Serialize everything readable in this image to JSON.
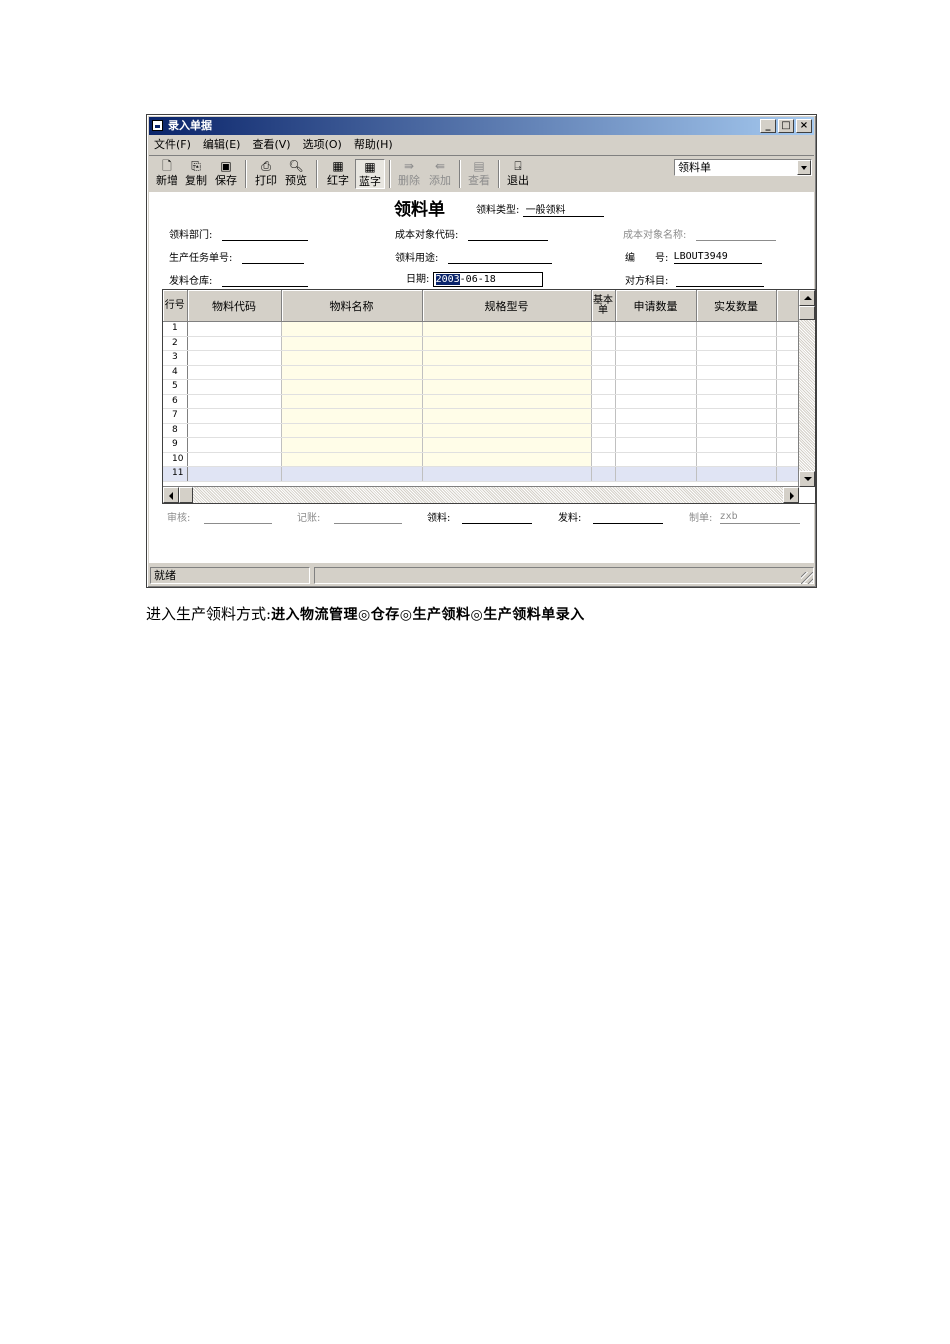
{
  "window": {
    "title": "录入单据",
    "controls": [
      "_",
      "□",
      "×"
    ]
  },
  "menu": [
    "文件(F)",
    "编辑(E)",
    "查看(V)",
    "选项(O)",
    "帮助(H)"
  ],
  "toolbar": {
    "new": "新增",
    "copy": "复制",
    "save": "保存",
    "print": "打印",
    "preview": "预览",
    "red": "红字",
    "blue": "蓝字",
    "delete": "删除",
    "add": "添加",
    "view": "查看",
    "exit": "退出",
    "doc_select": "领料单"
  },
  "form": {
    "title": "领料单",
    "pick_type_label": "领料类型:",
    "pick_type_value": "一般领料",
    "dept_label": "领料部门:",
    "task_label": "生产任务单号:",
    "warehouse_label": "发料仓库:",
    "cost_code_label": "成本对象代码:",
    "use_label": "领料用途:",
    "date_label": "日期:",
    "date_sel": "2003",
    "date_rest": "-06-18",
    "cost_name_label": "成本对象名称:",
    "number_label": "编　　号:",
    "number_value": "LBOUT3949",
    "contra_label": "对方科目:"
  },
  "grid": {
    "headers": [
      "行号",
      "物料代码",
      "物料名称",
      "规格型号",
      "基本单",
      "申请数量",
      "实发数量"
    ],
    "rows": [
      "1",
      "2",
      "3",
      "4",
      "5",
      "6",
      "7",
      "8",
      "9",
      "10",
      "11"
    ]
  },
  "footer": {
    "audit_label": "审核:",
    "post_label": "记账:",
    "picker_label": "领料:",
    "issuer_label": "发料:",
    "maker_label": "制单:",
    "maker_value": "zxb"
  },
  "status": {
    "text": "就绪"
  },
  "caption": {
    "prefix": "进入生产领料方式:",
    "path": "进入物流管理◎仓存◎生产领料◎生产领料单录入"
  }
}
